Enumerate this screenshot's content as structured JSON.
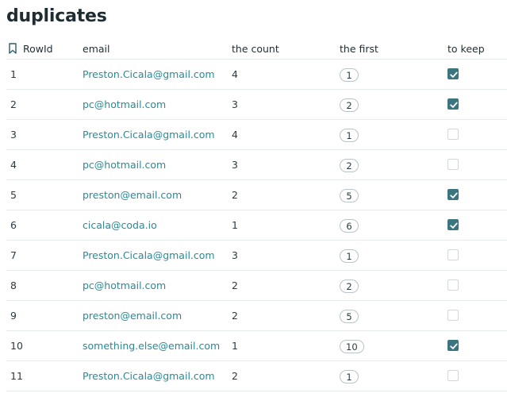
{
  "page": {
    "title": "duplicates"
  },
  "table": {
    "columns": {
      "rowid": "RowId",
      "email": "email",
      "count": "the count",
      "first": "the first",
      "keep": "to keep"
    },
    "rows": [
      {
        "rowid": "1",
        "email": "Preston.Cicala@gmail.com",
        "count": "4",
        "first": "1",
        "keep": true
      },
      {
        "rowid": "2",
        "email": "pc@hotmail.com",
        "count": "3",
        "first": "2",
        "keep": true
      },
      {
        "rowid": "3",
        "email": "Preston.Cicala@gmail.com",
        "count": "4",
        "first": "1",
        "keep": false
      },
      {
        "rowid": "4",
        "email": "pc@hotmail.com",
        "count": "3",
        "first": "2",
        "keep": false
      },
      {
        "rowid": "5",
        "email": "preston@email.com",
        "count": "2",
        "first": "5",
        "keep": true
      },
      {
        "rowid": "6",
        "email": "cicala@coda.io",
        "count": "1",
        "first": "6",
        "keep": true
      },
      {
        "rowid": "7",
        "email": "Preston.Cicala@gmail.com",
        "count": "3",
        "first": "1",
        "keep": false
      },
      {
        "rowid": "8",
        "email": "pc@hotmail.com",
        "count": "2",
        "first": "2",
        "keep": false
      },
      {
        "rowid": "9",
        "email": "preston@email.com",
        "count": "2",
        "first": "5",
        "keep": false
      },
      {
        "rowid": "10",
        "email": "something.else@email.com",
        "count": "1",
        "first": "10",
        "keep": true
      },
      {
        "rowid": "11",
        "email": "Preston.Cicala@gmail.com",
        "count": "2",
        "first": "1",
        "keep": false
      }
    ]
  },
  "icons": {
    "rowid_header": "bookmark-icon",
    "checked": "checkmark-icon"
  },
  "colors": {
    "link": "#2a8a96",
    "checkbox_checked": "#3a7580",
    "text": "#1f2d33"
  }
}
